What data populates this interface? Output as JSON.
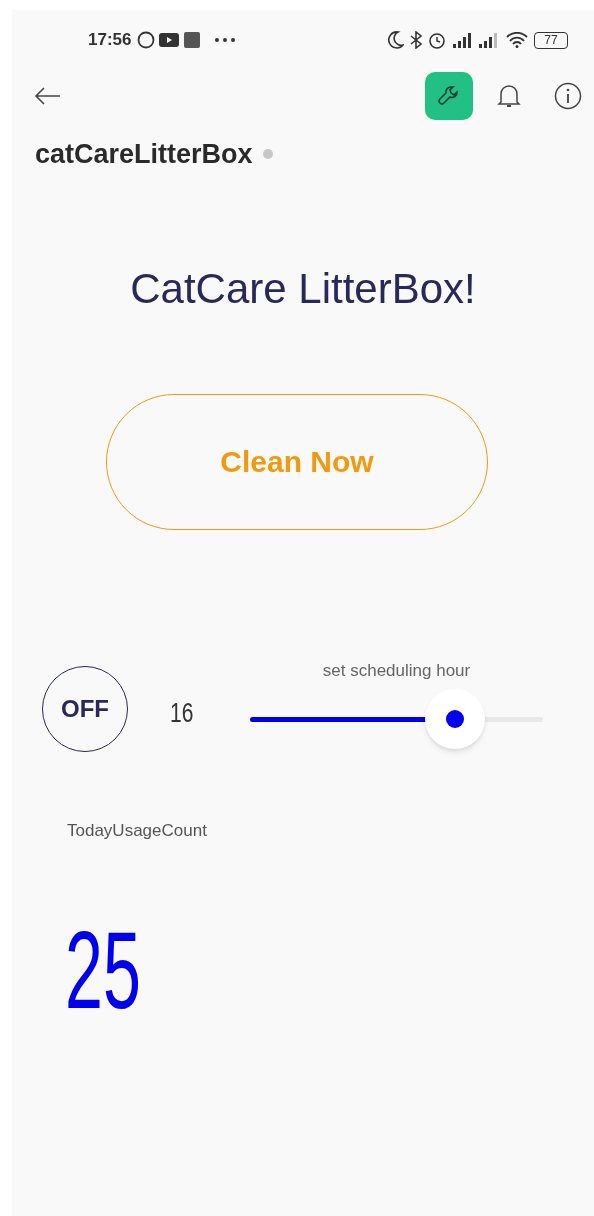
{
  "status_bar": {
    "time": "17:56",
    "battery": "77"
  },
  "toolbar": {
    "settings_selected": true
  },
  "device": {
    "name": "catCareLitterBox",
    "online": false
  },
  "widgets": {
    "title": "CatCare LitterBox!",
    "clean_button": {
      "label": "Clean Now"
    },
    "switch": {
      "label": "OFF",
      "on": false
    },
    "slider": {
      "label": "set scheduling hour",
      "reading": "16",
      "level": 0.7
    },
    "counter": {
      "label": "TodayUsageCount",
      "value": "25"
    }
  }
}
